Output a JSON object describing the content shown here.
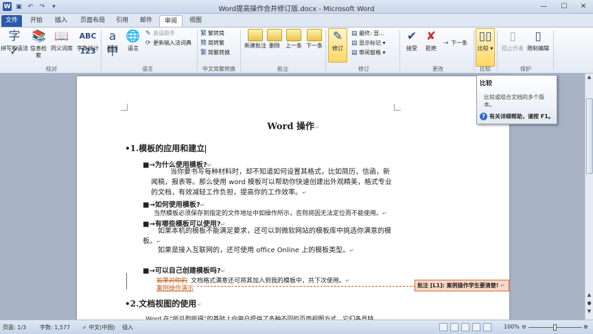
{
  "window": {
    "title": "Word提高操作合并修订版.docx - Microsoft Word",
    "qat_icons": [
      "word-app-icon",
      "save-icon",
      "undo-icon",
      "redo-icon",
      "customize-qat-icon"
    ],
    "controls": [
      "minimize-icon",
      "maximize-icon",
      "close-icon"
    ]
  },
  "tabs": [
    {
      "label": "文件"
    },
    {
      "label": "开始"
    },
    {
      "label": "插入"
    },
    {
      "label": "页面布局"
    },
    {
      "label": "引用"
    },
    {
      "label": "邮件"
    },
    {
      "label": "审阅",
      "active": true
    },
    {
      "label": "视图"
    }
  ],
  "ribbon": {
    "proofing": {
      "group": "校对",
      "spelling": "拼写和语法",
      "research": "信息检索",
      "thesaurus": "同义词库",
      "wordcount": "字数统计"
    },
    "language": {
      "group": "语言",
      "translate": "翻译",
      "language": "语言",
      "english_assistant": "英语助手",
      "update_ime": "更新输入法词典"
    },
    "chinese": {
      "group": "中文简繁转换",
      "to_traditional": "繁转简",
      "to_simplified": "简转繁",
      "convert": "简繁转换"
    },
    "comments": {
      "group": "批注",
      "new": "新建批注",
      "delete": "删除",
      "prev": "上一条",
      "next": "下一条"
    },
    "tracking": {
      "group": "修订",
      "track": "修订",
      "display": "最终: 显...",
      "show_markup": "显示标记",
      "pane": "审阅窗格"
    },
    "changes": {
      "group": "更改",
      "accept": "接受",
      "reject": "拒绝",
      "next": "下一条"
    },
    "compare": {
      "group": "比较",
      "compare": "比较"
    },
    "protect": {
      "group": "保护",
      "block_authors": "阻止作者",
      "restrict": "限制编辑"
    }
  },
  "tooltip": {
    "title": "比较",
    "body": "比较或组合文档的多个版本。",
    "help": "有关详细帮助，请按 F1。"
  },
  "document": {
    "title": "Word 操作",
    "section1": "1.模板的应用和建立",
    "q1": "为什么使用模板?",
    "p1": "当你要书写每种材料时，却不知道如何设置其格式，比如简历，信函，新闻稿，报表等。那么使用 word 模板可以帮助你快速创建出外观精美，格式专业的文档，有效减轻工作负担，提高你的工作效率。",
    "q2": "如何使用模板?",
    "p2": "当然模板必须保存到指定的文件地址中如操作所示，否则将因无法定位而不能使用。",
    "q3": "有哪些模板可以使用?",
    "p3a": "如果本机的模板不能满足要求，还可以到微软网站的模板库中挑选你满意的模板。",
    "p3b": "如果是接入互联网的，还可使用 office Online 上的模板类型。",
    "q4": "可以自己创建模板吗?",
    "p4_deleted": "如果对你的",
    "p4_text": "文档格式满意还可将其加入到我的模板中，共下次使用。",
    "p4_inserted": "案例操作演示",
    "section2": "2.文档视图的使用",
    "p5": "Word 在“所见即所得”的基础上向用户提供了多种不同的页面视图方式，它们各具特",
    "comment": "批注 [L1]: 案例操作学生要清楚!"
  },
  "statusbar": {
    "page": "页面: 1/3",
    "words": "字数: 1,577",
    "language": "中文(中国)",
    "mode": "插入",
    "zoom": "100%",
    "zoom_level": 1.0
  }
}
